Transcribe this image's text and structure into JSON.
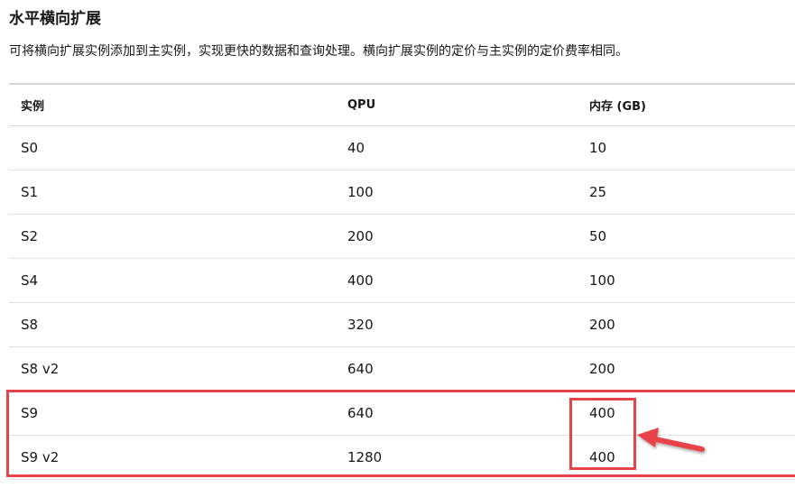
{
  "section": {
    "title": "水平横向扩展",
    "description": "可将横向扩展实例添加到主实例，实现更快的数据和查询处理。横向扩展实例的定价与主实例的定价费率相同。"
  },
  "table": {
    "headers": [
      "实例",
      "QPU",
      "内存 (GB)"
    ],
    "rows": [
      [
        "S0",
        "40",
        "10"
      ],
      [
        "S1",
        "100",
        "25"
      ],
      [
        "S2",
        "200",
        "50"
      ],
      [
        "S4",
        "400",
        "100"
      ],
      [
        "S8",
        "320",
        "200"
      ],
      [
        "S8 v2",
        "640",
        "200"
      ],
      [
        "S9",
        "640",
        "400"
      ],
      [
        "S9 v2",
        "1280",
        "400"
      ]
    ]
  },
  "annotations": {
    "highlight_color": "#e8434b",
    "arrow_icon": "arrow-left-icon"
  }
}
